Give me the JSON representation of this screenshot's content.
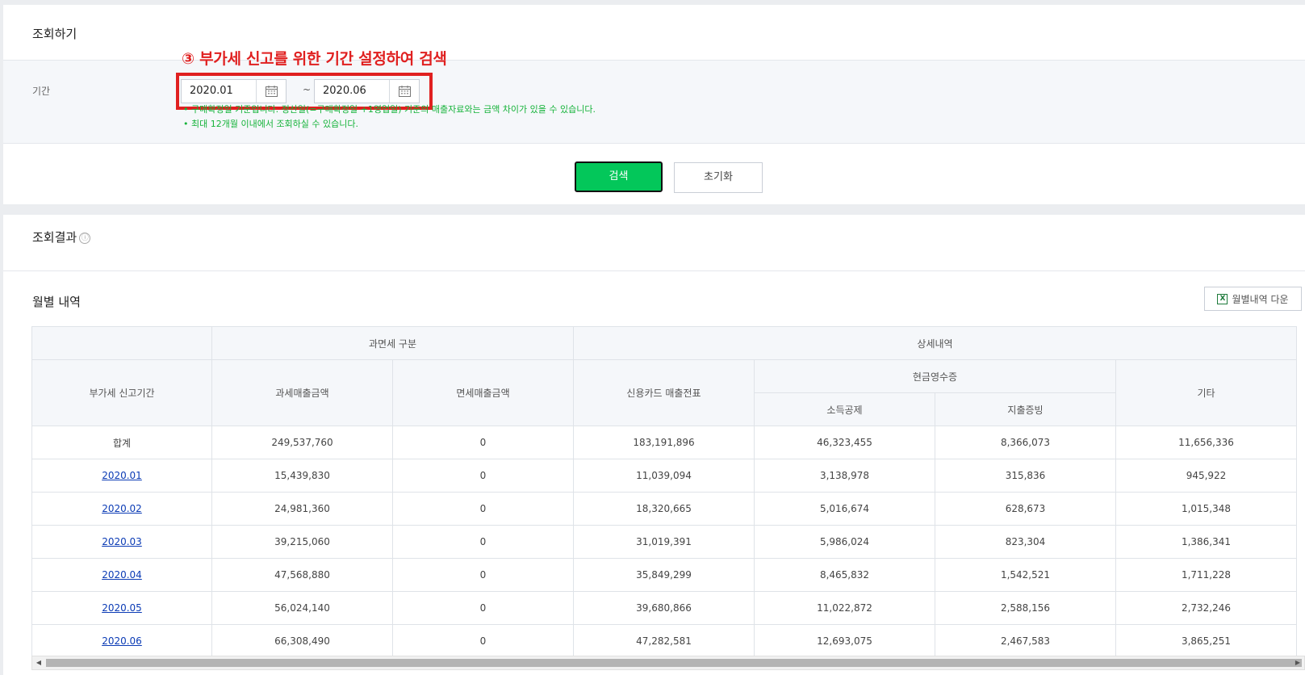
{
  "search": {
    "title": "조회하기",
    "period_label": "기간",
    "annotation": "③ 부가세 신고를 위한 기간 설정하여 검색",
    "start_date": "2020.01",
    "end_date": "2020.06",
    "separator": "~",
    "note1": "• 구매확정일 기준입니다. 정산일(=구매확정일 +1영업일) 기준의 매출자료와는 금액 차이가 있을 수 있습니다.",
    "note2": "• 최대 12개월 이내에서 조회하실 수 있습니다.",
    "search_button": "검색",
    "reset_button": "초기화"
  },
  "result": {
    "title": "조회결과",
    "info_icon": "ⓘ",
    "monthly_title": "월별 내역",
    "excel_button": "월별내역 다운",
    "excel_icon": "X",
    "headers": {
      "tax_group": "과면세 구분",
      "detail_group": "상세내역",
      "period": "부가세 신고기간",
      "taxable": "과세매출금액",
      "exempt": "면세매출금액",
      "card": "신용카드 매출전표",
      "cash_receipt": "현금영수증",
      "income_deduction": "소득공제",
      "expense_proof": "지출증빙",
      "other": "기타"
    },
    "total_row": {
      "label": "합계",
      "taxable": "249,537,760",
      "exempt": "0",
      "card": "183,191,896",
      "income": "46,323,455",
      "expense": "8,366,073",
      "other": "11,656,336"
    },
    "rows": [
      {
        "period": "2020.01",
        "taxable": "15,439,830",
        "exempt": "0",
        "card": "11,039,094",
        "income": "3,138,978",
        "expense": "315,836",
        "other": "945,922"
      },
      {
        "period": "2020.02",
        "taxable": "24,981,360",
        "exempt": "0",
        "card": "18,320,665",
        "income": "5,016,674",
        "expense": "628,673",
        "other": "1,015,348"
      },
      {
        "period": "2020.03",
        "taxable": "39,215,060",
        "exempt": "0",
        "card": "31,019,391",
        "income": "5,986,024",
        "expense": "823,304",
        "other": "1,386,341"
      },
      {
        "period": "2020.04",
        "taxable": "47,568,880",
        "exempt": "0",
        "card": "35,849,299",
        "income": "8,465,832",
        "expense": "1,542,521",
        "other": "1,711,228"
      },
      {
        "period": "2020.05",
        "taxable": "56,024,140",
        "exempt": "0",
        "card": "39,680,866",
        "income": "11,022,872",
        "expense": "2,588,156",
        "other": "2,732,246"
      },
      {
        "period": "2020.06",
        "taxable": "66,308,490",
        "exempt": "0",
        "card": "47,282,581",
        "income": "12,693,075",
        "expense": "2,467,583",
        "other": "3,865,251"
      }
    ]
  }
}
